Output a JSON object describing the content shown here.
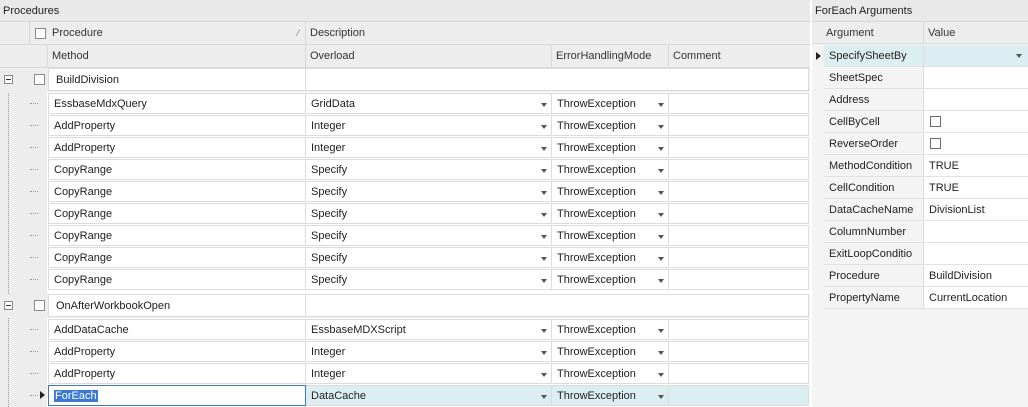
{
  "procedures": {
    "title": "Procedures",
    "header1": {
      "procedure": "Procedure",
      "description": "Description",
      "sort_glyph": "⁄"
    },
    "header2": {
      "method": "Method",
      "overload": "Overload",
      "error_mode": "ErrorHandlingMode",
      "comment": "Comment"
    },
    "groups": [
      {
        "name": "BuildDivision",
        "rows": [
          {
            "method": "EssbaseMdxQuery",
            "overload": "GridData",
            "error": "ThrowException"
          },
          {
            "method": "AddProperty",
            "overload": "Integer",
            "error": "ThrowException"
          },
          {
            "method": "AddProperty",
            "overload": "Integer",
            "error": "ThrowException"
          },
          {
            "method": "CopyRange",
            "overload": "Specify",
            "error": "ThrowException"
          },
          {
            "method": "CopyRange",
            "overload": "Specify",
            "error": "ThrowException"
          },
          {
            "method": "CopyRange",
            "overload": "Specify",
            "error": "ThrowException"
          },
          {
            "method": "CopyRange",
            "overload": "Specify",
            "error": "ThrowException"
          },
          {
            "method": "CopyRange",
            "overload": "Specify",
            "error": "ThrowException"
          },
          {
            "method": "CopyRange",
            "overload": "Specify",
            "error": "ThrowException"
          }
        ]
      },
      {
        "name": "OnAfterWorkbookOpen",
        "rows": [
          {
            "method": "AddDataCache",
            "overload": "EssbaseMDXScript",
            "error": "ThrowException"
          },
          {
            "method": "AddProperty",
            "overload": "Integer",
            "error": "ThrowException"
          },
          {
            "method": "AddProperty",
            "overload": "Integer",
            "error": "ThrowException"
          },
          {
            "method": "ForEach",
            "overload": "DataCache",
            "error": "ThrowException",
            "selected": true
          }
        ]
      }
    ]
  },
  "arguments": {
    "title": "ForEach Arguments",
    "col_argument": "Argument",
    "col_value": "Value",
    "rows": [
      {
        "name": "SpecifySheetBy",
        "value": "",
        "active": true,
        "dropdown": true
      },
      {
        "name": "SheetSpec",
        "value": ""
      },
      {
        "name": "Address",
        "value": ""
      },
      {
        "name": "CellByCell",
        "value": "",
        "checkbox": true,
        "checked": false
      },
      {
        "name": "ReverseOrder",
        "value": "",
        "checkbox": true,
        "checked": false
      },
      {
        "name": "MethodCondition",
        "value": "TRUE"
      },
      {
        "name": "CellCondition",
        "value": "TRUE"
      },
      {
        "name": "DataCacheName",
        "value": "DivisionList"
      },
      {
        "name": "ColumnNumber",
        "value": ""
      },
      {
        "name": "ExitLoopConditio",
        "value": ""
      },
      {
        "name": "Procedure",
        "value": "BuildDivision"
      },
      {
        "name": "PropertyName",
        "value": "CurrentLocation"
      }
    ]
  },
  "colors": {
    "selection": "#3a79d0",
    "active_row": "#ddeef3",
    "header_bg": "#ededed"
  }
}
